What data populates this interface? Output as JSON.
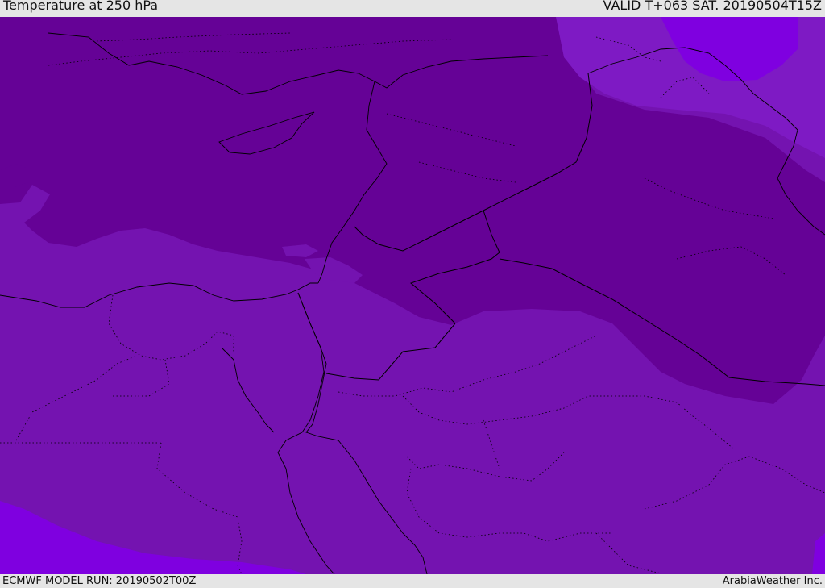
{
  "header": {
    "title": "Temperature at 250 hPa",
    "valid_time": "VALID T+063 SAT. 20190504T15Z"
  },
  "footer": {
    "model_run": "ECMWF MODEL RUN: 20190502T00Z",
    "credit": "ArabiaWeather Inc."
  },
  "colors": {
    "warmest_band": "#7413b0",
    "cold_band": "#650296",
    "mid_band": "#7e1ac4",
    "coldest_band": "#7f00e0",
    "boundary": "#000000"
  }
}
